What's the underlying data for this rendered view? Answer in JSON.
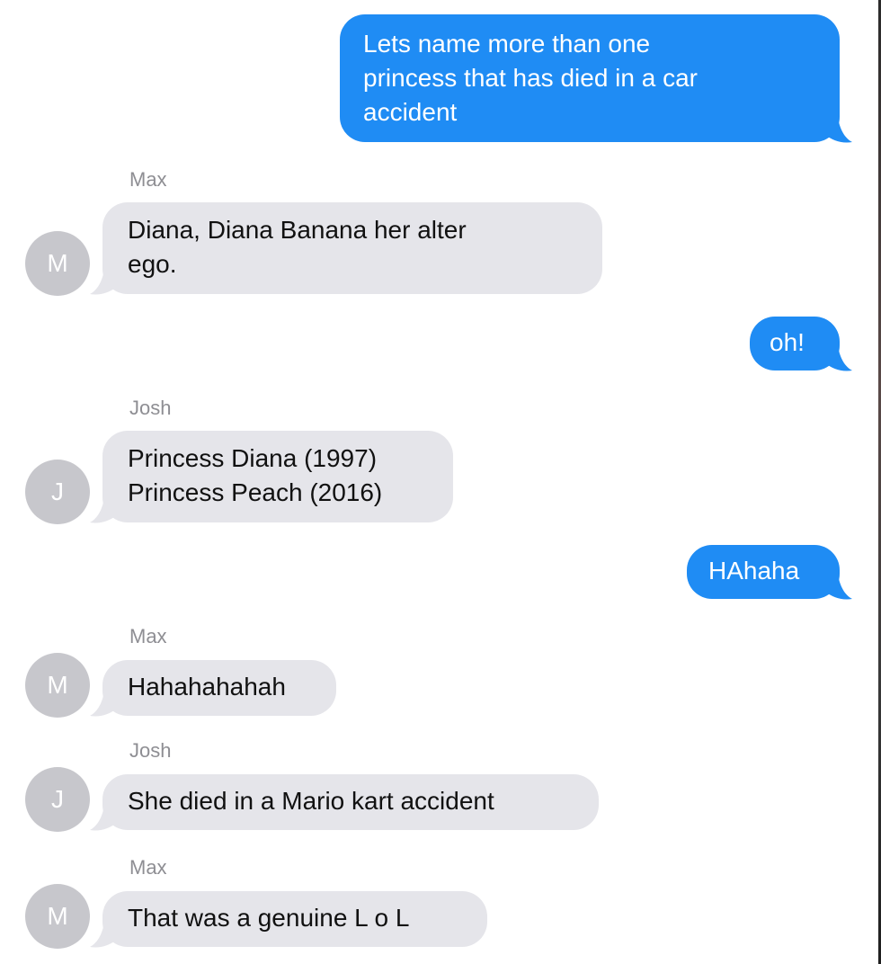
{
  "colors": {
    "outgoing_bubble": "#1f8cf4",
    "incoming_bubble": "#e5e5ea",
    "avatar_bg": "#c7c7cc",
    "sender_name": "#8e8e93"
  },
  "messages": [
    {
      "direction": "outgoing",
      "text": "Lets name more than one\nprincess that has died in a car\naccident"
    },
    {
      "direction": "incoming",
      "sender": "Max",
      "avatar_initial": "M",
      "text": "Diana, Diana Banana her alter\nego."
    },
    {
      "direction": "outgoing",
      "text": "oh!"
    },
    {
      "direction": "incoming",
      "sender": "Josh",
      "avatar_initial": "J",
      "text": "Princess Diana (1997)\nPrincess Peach (2016)"
    },
    {
      "direction": "outgoing",
      "text": "HAhaha"
    },
    {
      "direction": "incoming",
      "sender": "Max",
      "avatar_initial": "M",
      "text": "Hahahahahah"
    },
    {
      "direction": "incoming",
      "sender": "Josh",
      "avatar_initial": "J",
      "text": "She died in a Mario kart accident"
    },
    {
      "direction": "incoming",
      "sender": "Max",
      "avatar_initial": "M",
      "text": "That was a genuine L o L"
    }
  ]
}
